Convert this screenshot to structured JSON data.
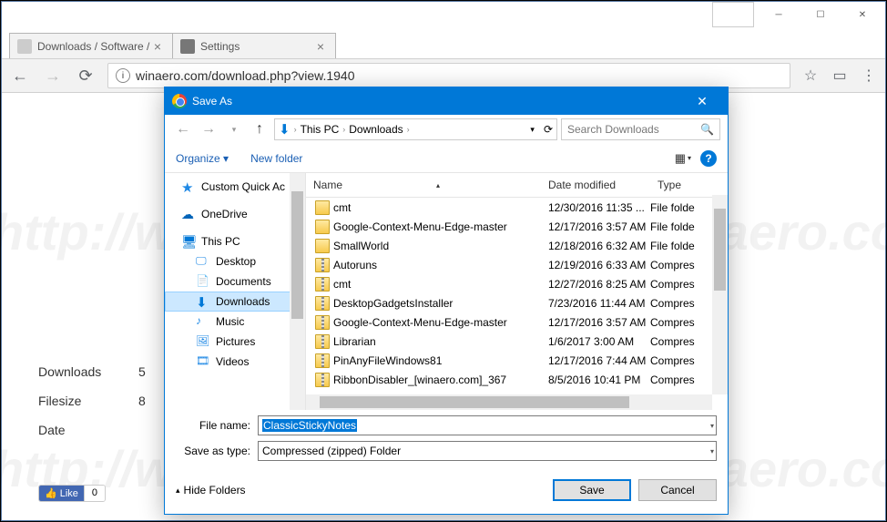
{
  "browser": {
    "tabs": [
      {
        "title": "Downloads / Software /",
        "active": true
      },
      {
        "title": "Settings",
        "active": false
      }
    ],
    "url": "winaero.com/download.php?view.1940",
    "win_controls": {
      "min": "minimize",
      "max": "maximize",
      "close": "close"
    }
  },
  "page": {
    "rows": [
      {
        "label": "Downloads",
        "value": "5"
      },
      {
        "label": "Filesize",
        "value": "8"
      },
      {
        "label": "Date",
        "value": ""
      }
    ],
    "fb": {
      "like": "Like",
      "count": "0"
    }
  },
  "dialog": {
    "title": "Save As",
    "nav": {
      "back": "back",
      "fwd": "forward",
      "up": "up"
    },
    "breadcrumb": [
      "This PC",
      "Downloads"
    ],
    "refresh": "refresh",
    "search_placeholder": "Search Downloads",
    "toolbar": {
      "organize": "Organize",
      "newfolder": "New folder",
      "view": "view",
      "help": "?"
    },
    "tree": [
      {
        "label": "Custom Quick Ac",
        "icon": "star",
        "indent": false
      },
      {
        "label": "OneDrive",
        "icon": "cloud",
        "indent": false
      },
      {
        "label": "This PC",
        "icon": "pc",
        "indent": false
      },
      {
        "label": "Desktop",
        "icon": "desktop",
        "indent": true
      },
      {
        "label": "Documents",
        "icon": "docs",
        "indent": true
      },
      {
        "label": "Downloads",
        "icon": "downloads",
        "indent": true,
        "selected": true
      },
      {
        "label": "Music",
        "icon": "music",
        "indent": true
      },
      {
        "label": "Pictures",
        "icon": "pictures",
        "indent": true
      },
      {
        "label": "Videos",
        "icon": "videos",
        "indent": true
      }
    ],
    "columns": {
      "name": "Name",
      "date": "Date modified",
      "type": "Type"
    },
    "files": [
      {
        "name": "cmt",
        "date": "12/30/2016 11:35 ...",
        "type": "File folde",
        "kind": "folder"
      },
      {
        "name": "Google-Context-Menu-Edge-master",
        "date": "12/17/2016 3:57 AM",
        "type": "File folde",
        "kind": "folder"
      },
      {
        "name": "SmallWorld",
        "date": "12/18/2016 6:32 AM",
        "type": "File folde",
        "kind": "folder"
      },
      {
        "name": "Autoruns",
        "date": "12/19/2016 6:33 AM",
        "type": "Compres",
        "kind": "zip"
      },
      {
        "name": "cmt",
        "date": "12/27/2016 8:25 AM",
        "type": "Compres",
        "kind": "zip"
      },
      {
        "name": "DesktopGadgetsInstaller",
        "date": "7/23/2016 11:44 AM",
        "type": "Compres",
        "kind": "zip"
      },
      {
        "name": "Google-Context-Menu-Edge-master",
        "date": "12/17/2016 3:57 AM",
        "type": "Compres",
        "kind": "zip"
      },
      {
        "name": "Librarian",
        "date": "1/6/2017 3:00 AM",
        "type": "Compres",
        "kind": "zip"
      },
      {
        "name": "PinAnyFileWindows81",
        "date": "12/17/2016 7:44 AM",
        "type": "Compres",
        "kind": "zip"
      },
      {
        "name": "RibbonDisabler_[winaero.com]_367",
        "date": "8/5/2016 10:41 PM",
        "type": "Compres",
        "kind": "zip"
      }
    ],
    "filename_label": "File name:",
    "filename_value": "ClassicStickyNotes",
    "saveastype_label": "Save as type:",
    "saveastype_value": "Compressed (zipped) Folder",
    "hide_folders": "Hide Folders",
    "save_btn": "Save",
    "cancel_btn": "Cancel"
  }
}
